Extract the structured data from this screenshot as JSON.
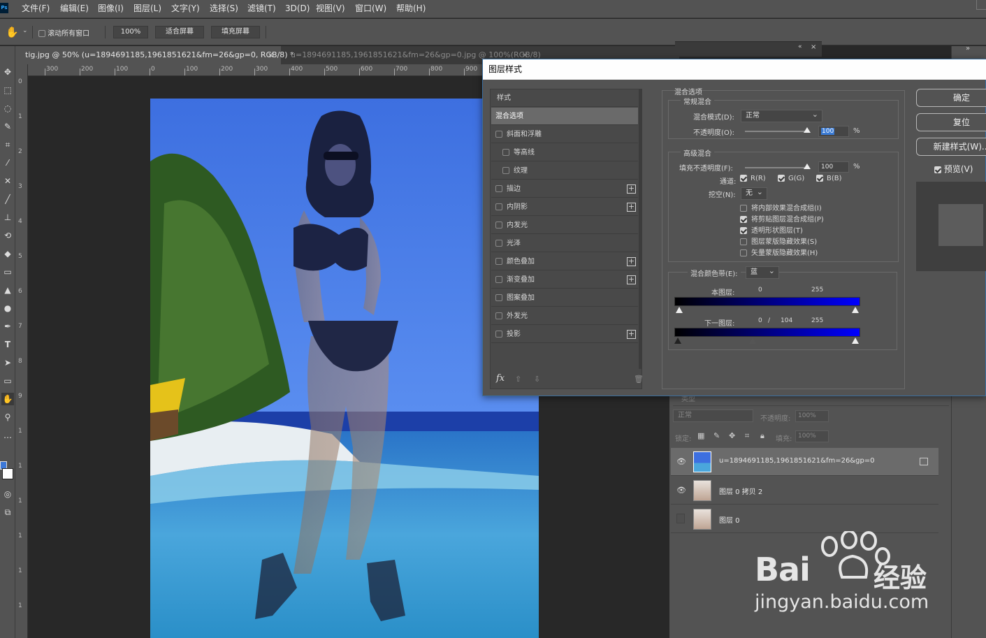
{
  "menubar": {
    "logo": "Ps",
    "items": [
      "文件(F)",
      "编辑(E)",
      "图像(I)",
      "图层(L)",
      "文字(Y)",
      "选择(S)",
      "滤镜(T)",
      "3D(D)",
      "视图(V)",
      "窗口(W)",
      "帮助(H)"
    ]
  },
  "options": {
    "scroll_all": "滚动所有窗口",
    "zoom": "100%",
    "fit_screen": "适合屏幕",
    "fill_screen": "填充屏幕"
  },
  "tabs": [
    {
      "label": "tig.jpg @ 50% (u=1894691185,1961851621&fm=26&gp=0, RGB/8) *",
      "close": "×"
    },
    {
      "label": "u=1894691185,1961851621&fm=26&gp=0.jpg @ 100%(RGB/8)",
      "close": "×"
    }
  ],
  "ruler_h": [
    "300",
    "200",
    "100",
    "0",
    "100",
    "200",
    "300",
    "400",
    "500",
    "600",
    "700",
    "800",
    "900"
  ],
  "ruler_v": [
    "0",
    "1",
    "2",
    "3",
    "4",
    "5",
    "6",
    "7",
    "8",
    "9",
    "1",
    "1",
    "1",
    "1",
    "1",
    "1"
  ],
  "dialog": {
    "title": "图层样式",
    "styles_header": "样式",
    "styles": [
      {
        "label": "混合选项",
        "checkbox": false,
        "plus": false,
        "selected": true
      },
      {
        "label": "斜面和浮雕",
        "checkbox": true,
        "checked": false,
        "plus": false
      },
      {
        "label": "等高线",
        "checkbox": true,
        "checked": false,
        "plus": false,
        "indent": true
      },
      {
        "label": "纹理",
        "checkbox": true,
        "checked": false,
        "plus": false,
        "indent": true
      },
      {
        "label": "描边",
        "checkbox": true,
        "checked": false,
        "plus": true
      },
      {
        "label": "内阴影",
        "checkbox": true,
        "checked": false,
        "plus": true
      },
      {
        "label": "内发光",
        "checkbox": true,
        "checked": false,
        "plus": false
      },
      {
        "label": "光泽",
        "checkbox": true,
        "checked": false,
        "plus": false
      },
      {
        "label": "颜色叠加",
        "checkbox": true,
        "checked": false,
        "plus": true
      },
      {
        "label": "渐变叠加",
        "checkbox": true,
        "checked": false,
        "plus": true
      },
      {
        "label": "图案叠加",
        "checkbox": true,
        "checked": false,
        "plus": false
      },
      {
        "label": "外发光",
        "checkbox": true,
        "checked": false,
        "plus": false
      },
      {
        "label": "投影",
        "checkbox": true,
        "checked": false,
        "plus": true
      }
    ],
    "fx_label": "fx",
    "blend_section": "混合选项",
    "general_blend": "常规混合",
    "blend_mode_label": "混合模式(D):",
    "blend_mode_value": "正常",
    "opacity_label": "不透明度(O):",
    "opacity_value": "100",
    "percent": "%",
    "advanced_blend": "高级混合",
    "fill_opacity_label": "填充不透明度(F):",
    "fill_opacity_value": "100",
    "channels_label": "通道:",
    "channels": [
      {
        "label": "R(R)",
        "checked": true
      },
      {
        "label": "G(G)",
        "checked": true
      },
      {
        "label": "B(B)",
        "checked": true
      }
    ],
    "knockout_label": "挖空(N):",
    "knockout_value": "无",
    "advanced_options": [
      {
        "label": "将内部效果混合成组(I)",
        "checked": false
      },
      {
        "label": "将剪贴图层混合成组(P)",
        "checked": true
      },
      {
        "label": "透明形状图层(T)",
        "checked": true
      },
      {
        "label": "图层蒙版隐藏效果(S)",
        "checked": false
      },
      {
        "label": "矢量蒙版隐藏效果(H)",
        "checked": false
      }
    ],
    "blend_if_label": "混合颜色带(E):",
    "blend_if_value": "蓝",
    "this_layer_label": "本图层:",
    "this_layer_min": "0",
    "this_layer_max": "255",
    "underlying_label": "下一图层:",
    "underlying_min": "0",
    "underlying_sep": "/",
    "underlying_mid": "104",
    "underlying_max": "255",
    "ok": "确定",
    "reset": "复位",
    "new_style": "新建样式(W)...",
    "preview_label": "预览(V)",
    "preview_checked": true
  },
  "layers_panel": {
    "search": "类型",
    "mode": "正常",
    "opacity_label": "不透明度:",
    "opacity_value": "100%",
    "lock_label": "锁定:",
    "fill_label": "填充:",
    "fill_value": "100%",
    "layers": [
      {
        "name": "u=1894691185,1961851621&fm=26&gp=0",
        "visible": true,
        "selected": true
      },
      {
        "name": "图层 0 拷贝 2",
        "visible": true,
        "selected": false
      },
      {
        "name": "图层 0",
        "visible": false,
        "selected": false
      }
    ]
  },
  "watermark": {
    "brand_a": "Bai",
    "brand_b": "经验",
    "url": "jingyan.baidu.com"
  }
}
